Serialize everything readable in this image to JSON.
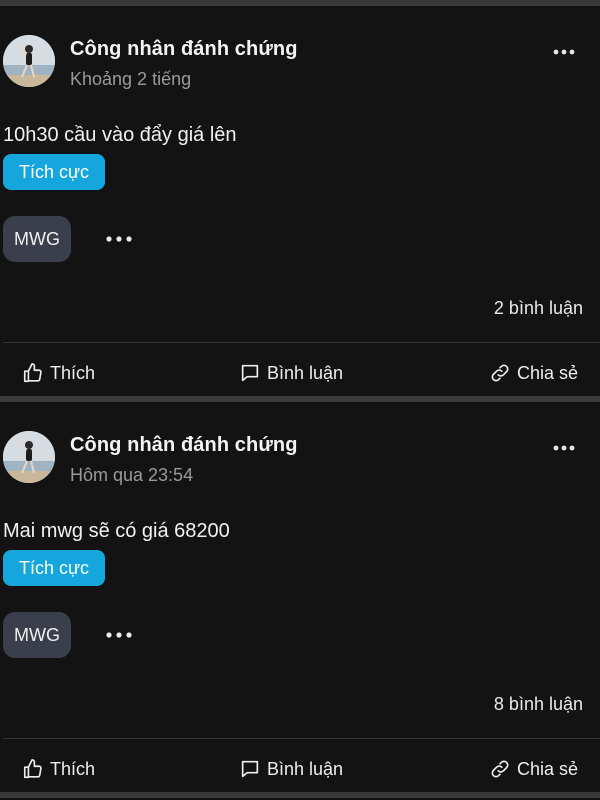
{
  "posts": [
    {
      "author": "Công nhân đánh chứng",
      "time": "Khoảng 2 tiếng",
      "content": "10h30 cầu vào đẩy giá lên",
      "sentiment": "Tích cực",
      "ticker": "MWG",
      "comments": "2 bình luận",
      "actions": {
        "like": "Thích",
        "comment": "Bình luận",
        "share": "Chia sẻ"
      }
    },
    {
      "author": "Công nhân đánh chứng",
      "time": "Hôm qua 23:54",
      "content": "Mai mwg sẽ có giá 68200",
      "sentiment": "Tích cực",
      "ticker": "MWG",
      "comments": "8 bình luận",
      "actions": {
        "like": "Thích",
        "comment": "Bình luận",
        "share": "Chia sẻ"
      }
    }
  ],
  "colors": {
    "background": "#121212",
    "sentiment_badge": "#14a6dc",
    "ticker_chip": "#3a3f4b",
    "divider": "#3a3a3c"
  },
  "icons": {
    "more": "more-horizontal-icon",
    "like": "thumbs-up-icon",
    "comment": "comment-icon",
    "share": "link-icon"
  }
}
